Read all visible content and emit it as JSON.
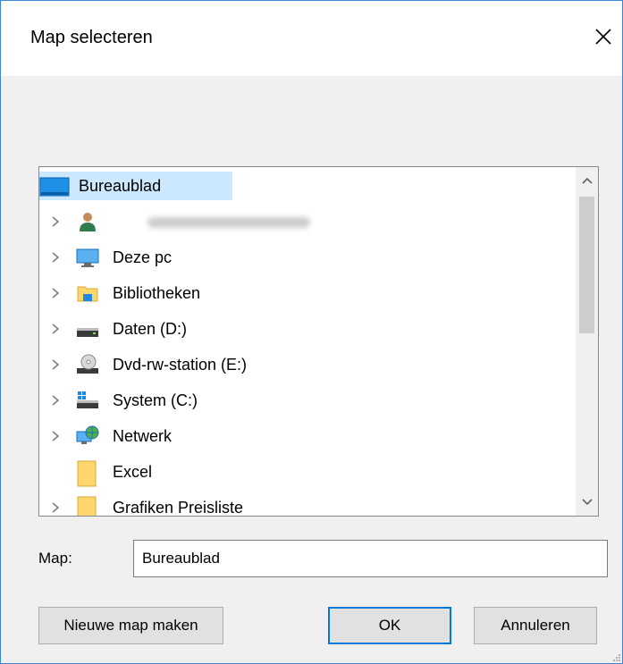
{
  "window": {
    "title": "Map selecteren",
    "close_icon": "close-icon"
  },
  "tree": {
    "root": {
      "label": "Bureaublad",
      "icon": "desktop-icon",
      "selected": true
    },
    "items": [
      {
        "label": "",
        "icon": "user-icon",
        "blurred": true,
        "expandable": true
      },
      {
        "label": "Deze pc",
        "icon": "computer-icon",
        "expandable": true
      },
      {
        "label": "Bibliotheken",
        "icon": "libraries-icon",
        "expandable": true
      },
      {
        "label": "Daten (D:)",
        "icon": "drive-icon",
        "expandable": true
      },
      {
        "label": "Dvd-rw-station (E:)",
        "icon": "dvd-drive-icon",
        "expandable": true
      },
      {
        "label": "System (C:)",
        "icon": "system-drive-icon",
        "expandable": true
      },
      {
        "label": "Netwerk",
        "icon": "network-icon",
        "expandable": true
      },
      {
        "label": "Excel",
        "icon": "folder-icon",
        "expandable": false
      },
      {
        "label": "Grafiken Preisliste",
        "icon": "folder-icon",
        "expandable": true
      }
    ]
  },
  "folder_field": {
    "label": "Map:",
    "value": "Bureaublad"
  },
  "buttons": {
    "new_folder": "Nieuwe map maken",
    "ok": "OK",
    "cancel": "Annuleren"
  },
  "colors": {
    "selection": "#cce8ff",
    "accent": "#0078d7",
    "folder": "#ffd66b"
  }
}
